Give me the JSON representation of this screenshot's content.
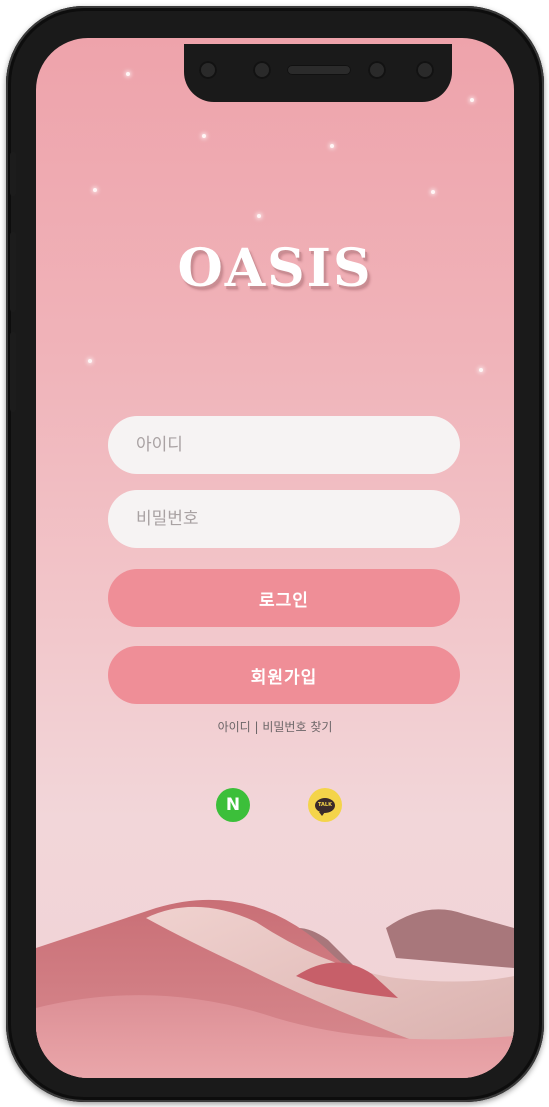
{
  "app": {
    "logo_text": "OASIS"
  },
  "login_form": {
    "id_placeholder": "아이디",
    "password_placeholder": "비밀번호",
    "login_label": "로그인",
    "signup_label": "회원가입",
    "find_account_label": "아이디 | 비밀번호 찾기"
  },
  "social_login": {
    "naver_label": "N",
    "kakao_label": "TALK"
  },
  "icons": [
    "naver-icon",
    "kakaotalk-icon"
  ],
  "colors": {
    "primary_button": "#ef8e97",
    "background_top": "#eea3ab",
    "naver_green": "#3cbf3a",
    "kakao_yellow": "#f4d44a"
  }
}
